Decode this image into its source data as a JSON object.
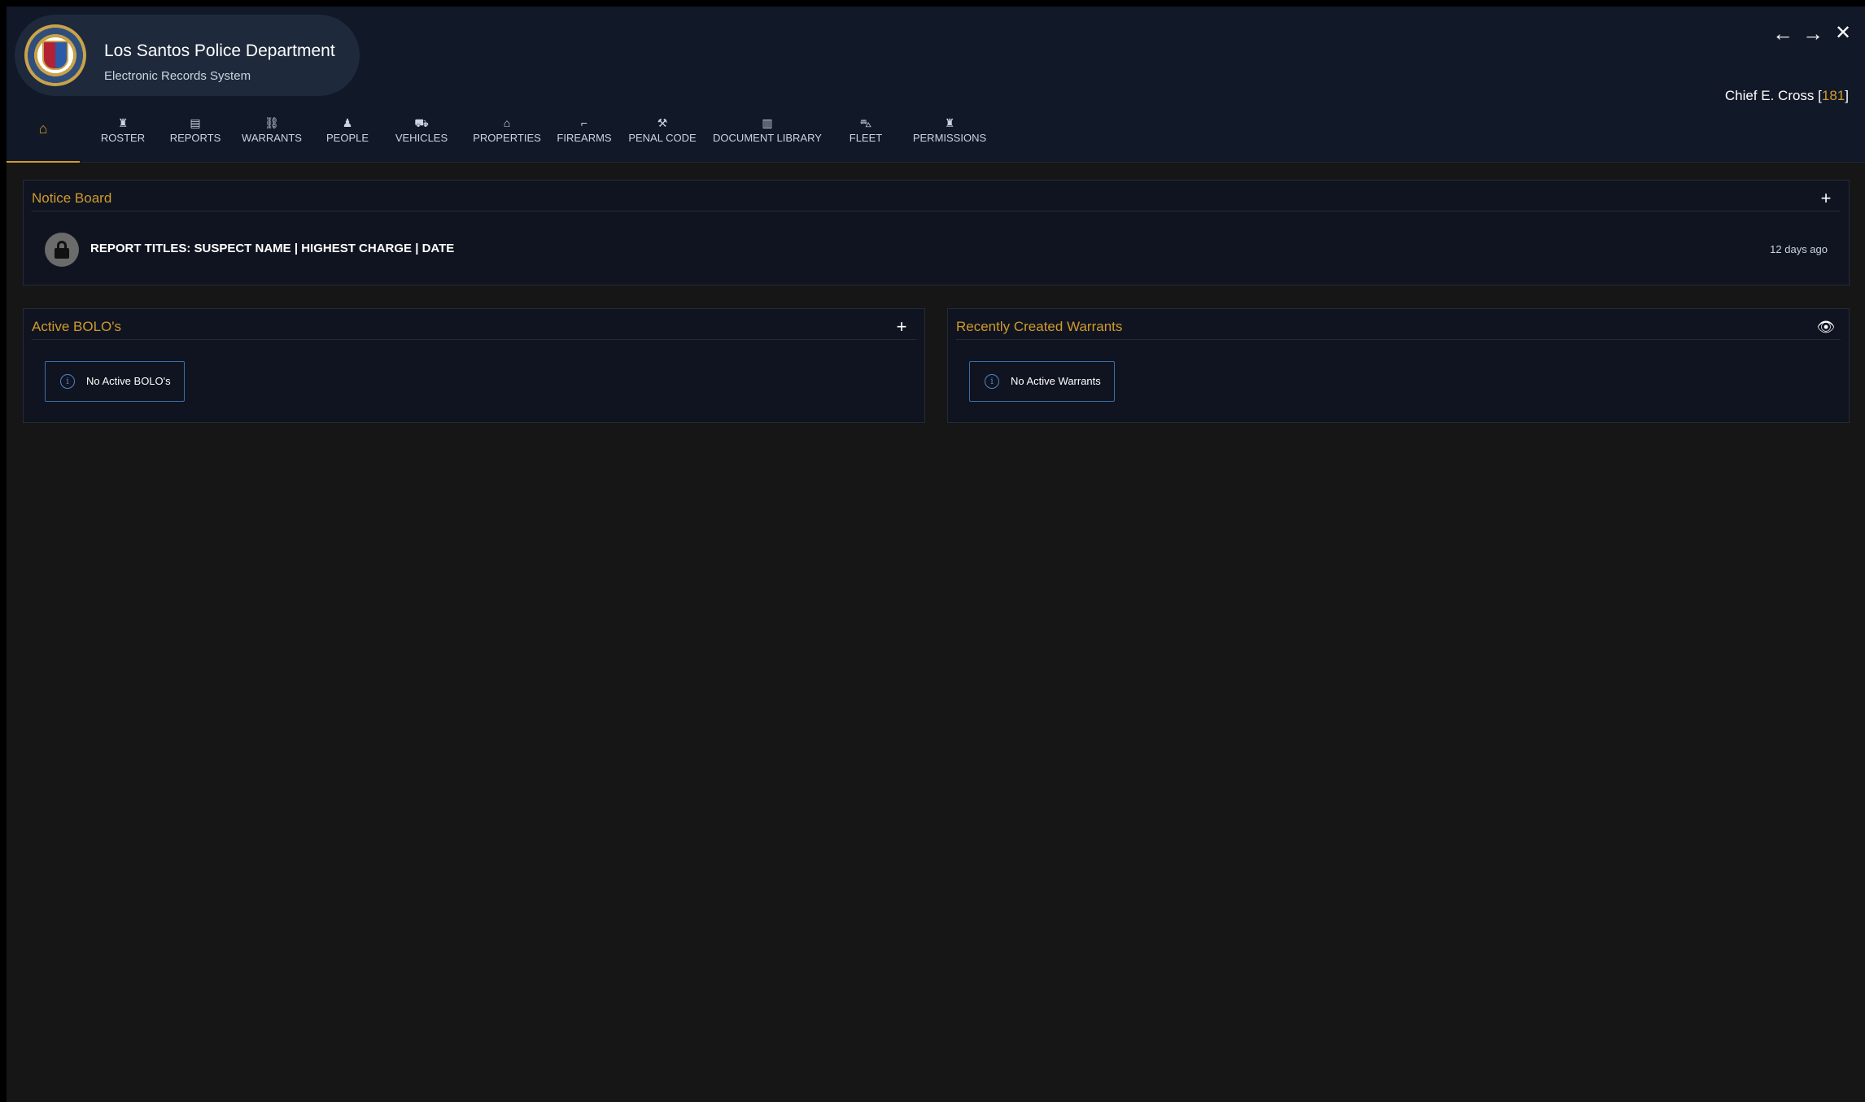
{
  "header": {
    "title": "Los Santos Police Department",
    "subtitle": "Electronic Records System",
    "controls": {
      "back": "←",
      "forward": "→",
      "close": "✕"
    },
    "user": {
      "prefix": "Chief E. Cross [",
      "badge": "181",
      "suffix": "]"
    }
  },
  "nav": {
    "items": [
      {
        "label": "",
        "icon": "home-icon",
        "glyph": "⌂"
      },
      {
        "label": "ROSTER",
        "icon": "officer-icon",
        "glyph": "♜"
      },
      {
        "label": "REPORTS",
        "icon": "file-icon",
        "glyph": "▤"
      },
      {
        "label": "WARRANTS",
        "icon": "handcuffs-icon",
        "glyph": "⛓"
      },
      {
        "label": "PEOPLE",
        "icon": "person-icon",
        "glyph": "♟"
      },
      {
        "label": "VEHICLES",
        "icon": "car-icon",
        "glyph": "⛟"
      },
      {
        "label": "PROPERTIES",
        "icon": "house-icon",
        "glyph": "⌂"
      },
      {
        "label": "FIREARMS",
        "icon": "gun-icon",
        "glyph": "⌐"
      },
      {
        "label": "PENAL CODE",
        "icon": "gavel-icon",
        "glyph": "⚒"
      },
      {
        "label": "DOCUMENT LIBRARY",
        "icon": "books-icon",
        "glyph": "▥"
      },
      {
        "label": "FLEET",
        "icon": "car-front-icon",
        "glyph": "⛍"
      },
      {
        "label": "PERMISSIONS",
        "icon": "user-shield-icon",
        "glyph": "♜"
      }
    ],
    "active_color": "#d19a2b"
  },
  "notice_board": {
    "title": "Notice Board",
    "add": "+",
    "items": [
      {
        "text": "REPORT TITLES: SUSPECT NAME | HIGHEST CHARGE | DATE",
        "time": "12 days ago",
        "icon": "lock-icon"
      }
    ]
  },
  "bolos": {
    "title": "Active BOLO's",
    "add": "+",
    "empty": "No Active BOLO's"
  },
  "warrants": {
    "title": "Recently Created Warrants",
    "view": "👁",
    "empty": "No Active Warrants"
  },
  "colors": {
    "accent": "#d19a2b",
    "header_bg": "#111827",
    "panel_bg": "#0f1420",
    "info_border": "#3b6ea8"
  }
}
